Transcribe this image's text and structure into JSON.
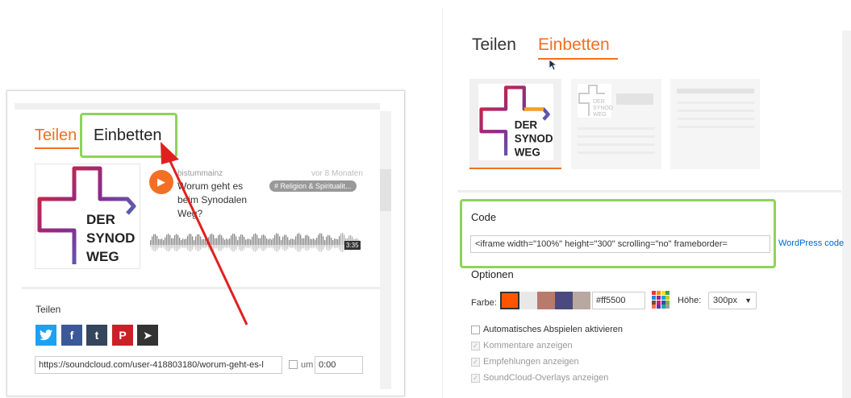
{
  "left_panel": {
    "tabs": {
      "share": "Teilen",
      "embed": "Einbetten"
    },
    "track": {
      "user": "bistummainz",
      "time": "vor 8 Monaten",
      "title": "Worum geht es beim Synodalen Weg?",
      "tag": "# Religion & Spiritualit...",
      "duration": "3:35",
      "play_icon": "play-icon"
    },
    "artwork": {
      "line1": "DER",
      "line2": "SYNOD",
      "line3": "WEG"
    },
    "share": {
      "label": "Teilen",
      "buttons": [
        {
          "name": "twitter",
          "glyph": "🐦",
          "color": "#1da1f2"
        },
        {
          "name": "facebook",
          "glyph": "f",
          "color": "#3b5998"
        },
        {
          "name": "tumblr",
          "glyph": "t",
          "color": "#35465c"
        },
        {
          "name": "pinterest",
          "glyph": "P",
          "color": "#cb2027"
        },
        {
          "name": "send",
          "glyph": "➤",
          "color": "#333333"
        }
      ],
      "url": "https://soundcloud.com/user-418803180/worum-geht-es-l",
      "at_label": "um",
      "at_value": "0:00"
    }
  },
  "right_panel": {
    "tabs": {
      "share": "Teilen",
      "embed": "Einbetten"
    },
    "artwork": {
      "line1": "DER",
      "line2": "SYNOD",
      "line3": "WEG"
    },
    "code": {
      "label": "Code",
      "value": "<iframe width=\"100%\" height=\"300\" scrolling=\"no\" frameborder=",
      "wordpress_link": "WordPress code"
    },
    "options": {
      "label": "Optionen",
      "color_label": "Farbe:",
      "swatches": [
        "#ff5500",
        "#e8e8e8",
        "#b97a6e",
        "#4a4a7e",
        "#b8a8a0"
      ],
      "hex_value": "#ff5500",
      "height_label": "Höhe:",
      "height_value": "300px",
      "checkboxes": [
        {
          "label": "Automatisches Abspielen aktivieren",
          "checked": false,
          "disabled": false
        },
        {
          "label": "Kommentare anzeigen",
          "checked": true,
          "disabled": true
        },
        {
          "label": "Empfehlungen anzeigen",
          "checked": true,
          "disabled": true
        },
        {
          "label": "SoundCloud-Overlays anzeigen",
          "checked": true,
          "disabled": true
        }
      ]
    }
  },
  "colors": {
    "accent": "#f26f23",
    "highlight": "#8ed35a",
    "arrow": "#e02020"
  }
}
